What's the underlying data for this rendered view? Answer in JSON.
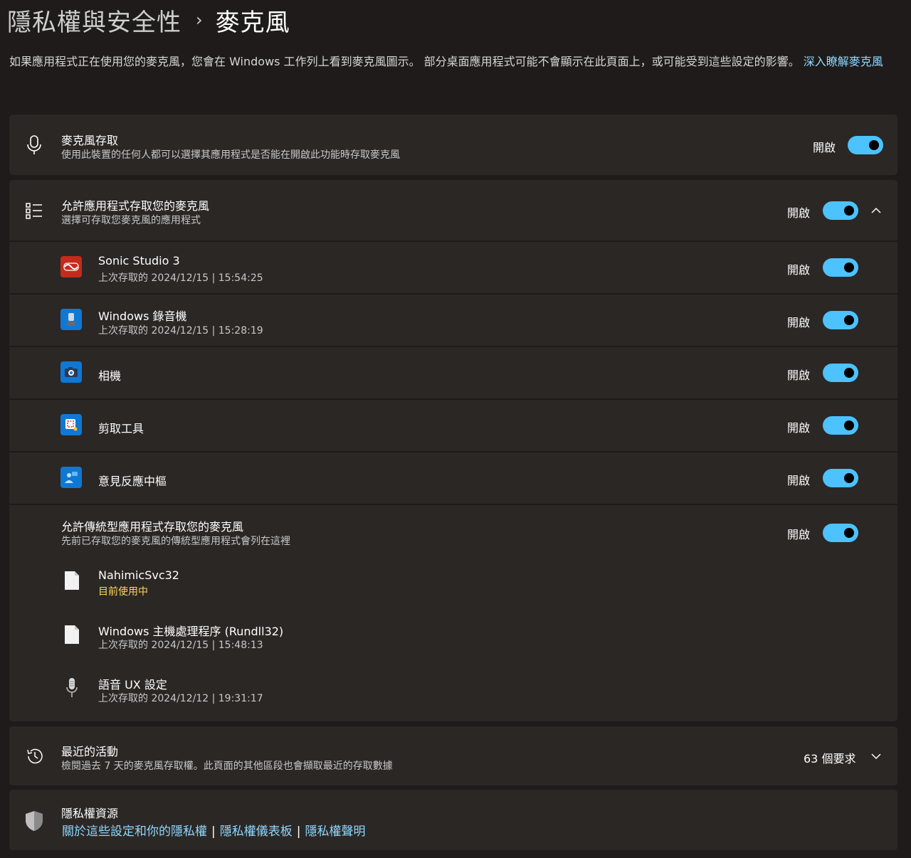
{
  "breadcrumb": {
    "parent": "隱私權與安全性",
    "separator": "›",
    "current": "麥克風"
  },
  "description": {
    "text": "如果應用程式正在使用您的麥克風，您會在 Windows 工作列上看到麥克風圖示。 部分桌面應用程式可能不會顯示在此頁面上，或可能受到這些設定的影響。 ",
    "link": "深入瞭解麥克風"
  },
  "mic_access": {
    "title": "麥克風存取",
    "subtitle": "使用此裝置的任何人都可以選擇其應用程式是否能在開啟此功能時存取麥克風",
    "state": "開啟",
    "icon": "microphone-icon"
  },
  "app_access": {
    "title": "允許應用程式存取您的麥克風",
    "subtitle": "選擇可存取您麥克風的應用程式",
    "state": "開啟",
    "icon": "list-icon",
    "apps": [
      {
        "name": "Sonic Studio 3",
        "subtitle": "上次存取的 2024/12/15 | 15:54:25",
        "state": "開啟",
        "icon": "sonic-studio-icon",
        "color": "#c42b1c"
      },
      {
        "name": "Windows 錄音機",
        "subtitle": "上次存取的 2024/12/15 | 15:28:19",
        "state": "開啟",
        "icon": "sound-recorder-icon",
        "color": "#0f78d4"
      },
      {
        "name": "相機",
        "subtitle": "",
        "state": "開啟",
        "icon": "camera-icon",
        "color": "#0f78d4"
      },
      {
        "name": "剪取工具",
        "subtitle": "",
        "state": "開啟",
        "icon": "snipping-tool-icon",
        "color": "#0f78d4"
      },
      {
        "name": "意見反應中樞",
        "subtitle": "",
        "state": "開啟",
        "icon": "feedback-hub-icon",
        "color": "#0f78d4"
      }
    ]
  },
  "desktop_access": {
    "title": "允許傳統型應用程式存取您的麥克風",
    "subtitle": "先前已存取您的麥克風的傳統型應用程式會列在這裡",
    "state": "開啟",
    "apps": [
      {
        "name": "NahimicSvc32",
        "subtitle": "目前使用中",
        "icon": "file-icon"
      },
      {
        "name": "Windows 主機處理程序 (Rundll32)",
        "subtitle": "上次存取的 2024/12/15 | 15:48:13",
        "icon": "file-icon"
      },
      {
        "name": "語音 UX 設定",
        "subtitle": "上次存取的 2024/12/12 | 19:31:17",
        "icon": "speech-microphone-icon"
      }
    ]
  },
  "recent_activity": {
    "title": "最近的活動",
    "subtitle": "檢閱過去 7 天的麥克風存取權。此頁面的其他區段也會擷取最近的存取數據",
    "count": "63 個要求",
    "icon": "history-icon"
  },
  "privacy_resources": {
    "title": "隱私權資源",
    "links": [
      "關於這些設定和你的隱私權",
      "隱私權儀表板",
      "隱私權聲明"
    ],
    "separator": "|",
    "icon": "shield-icon"
  },
  "colors": {
    "accent": "#4cc2ff",
    "background": "#1f1b1a",
    "card": "#2b2725",
    "link": "#8fd8ff",
    "active": "#ffd75e"
  }
}
